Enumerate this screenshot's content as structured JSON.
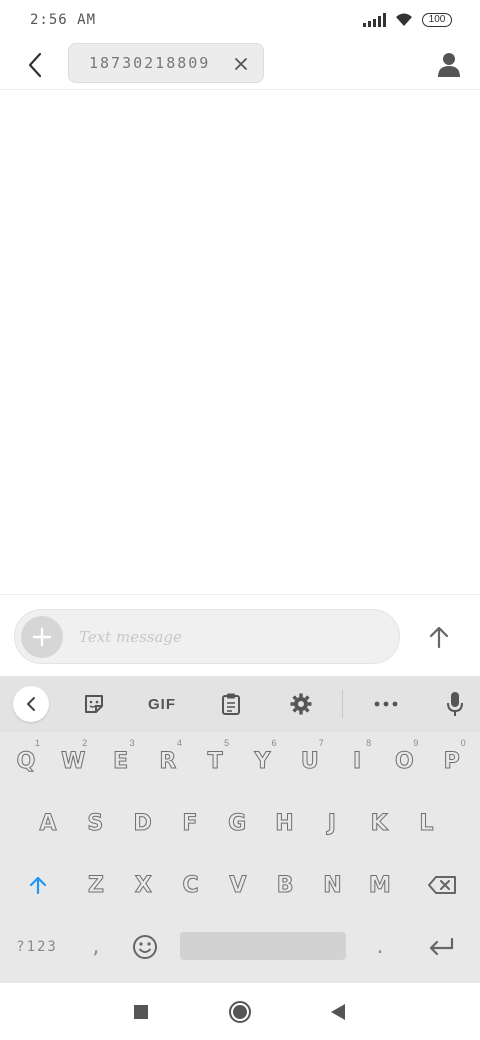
{
  "status_bar": {
    "time": "2:56 AM",
    "battery": "100",
    "icons": [
      "signal-icon",
      "wifi-icon",
      "battery-icon"
    ]
  },
  "header": {
    "back_icon": "chevron-left-icon",
    "recipient": "18730218809",
    "remove_recipient_icon": "close-icon",
    "contact_icon": "person-icon"
  },
  "compose": {
    "attach_icon": "plus-icon",
    "placeholder": "Text message",
    "value": "",
    "send_icon": "arrow-up-icon"
  },
  "keyboard": {
    "toolbar": {
      "collapse_icon": "chevron-left-icon",
      "sticker_icon": "sticker-icon",
      "gif_label": "GIF",
      "clipboard_icon": "clipboard-icon",
      "settings_icon": "gear-icon",
      "more_icon": "more-horizontal-icon",
      "mic_icon": "microphone-icon"
    },
    "row1": [
      {
        "key": "Q",
        "hint": "1"
      },
      {
        "key": "W",
        "hint": "2"
      },
      {
        "key": "E",
        "hint": "3"
      },
      {
        "key": "R",
        "hint": "4"
      },
      {
        "key": "T",
        "hint": "5"
      },
      {
        "key": "Y",
        "hint": "6"
      },
      {
        "key": "U",
        "hint": "7"
      },
      {
        "key": "I",
        "hint": "8"
      },
      {
        "key": "O",
        "hint": "9"
      },
      {
        "key": "P",
        "hint": "0"
      }
    ],
    "row2": [
      "A",
      "S",
      "D",
      "F",
      "G",
      "H",
      "J",
      "K",
      "L"
    ],
    "row3": [
      "Z",
      "X",
      "C",
      "V",
      "B",
      "N",
      "M"
    ],
    "shift_icon": "shift-arrow-icon",
    "backspace_icon": "backspace-icon",
    "symbols_label": "?123",
    "comma": ",",
    "emoji_icon": "emoji-icon",
    "period": ".",
    "enter_icon": "enter-icon",
    "accent_color": "#2196f3"
  },
  "nav_bar": {
    "icons": [
      "recents-square-icon",
      "home-circle-icon",
      "back-triangle-icon"
    ]
  }
}
